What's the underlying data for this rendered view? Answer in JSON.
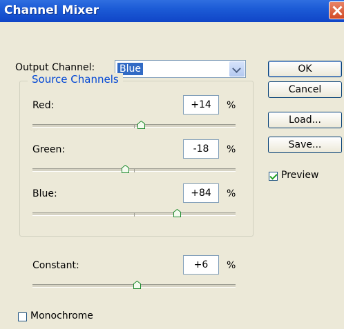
{
  "window": {
    "title": "Channel Mixer"
  },
  "output_channel": {
    "label": "Output Channel:",
    "value": "Blue"
  },
  "buttons": {
    "ok": "OK",
    "cancel": "Cancel",
    "load": "Load...",
    "save": "Save..."
  },
  "preview": {
    "label": "Preview",
    "checked": true
  },
  "source_channels": {
    "title": "Source Channels",
    "channels": [
      {
        "label": "Red:",
        "value": "+14",
        "unit": "%",
        "percent": 14
      },
      {
        "label": "Green:",
        "value": "-18",
        "unit": "%",
        "percent": -18
      },
      {
        "label": "Blue:",
        "value": "+84",
        "unit": "%",
        "percent": 84
      }
    ]
  },
  "constant": {
    "label": "Constant:",
    "value": "+6",
    "unit": "%",
    "percent": 6
  },
  "monochrome": {
    "label": "Monochrome",
    "checked": false
  },
  "colors": {
    "title_bar": "#1c5bd6",
    "accent": "#0046d5",
    "selection": "#316ac5",
    "close": "#d24a26"
  }
}
